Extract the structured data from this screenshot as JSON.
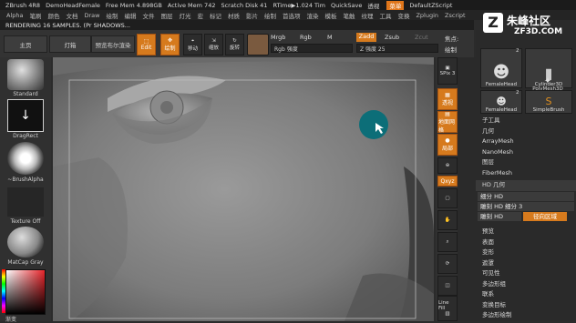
{
  "titlebar": {
    "app": "ZBrush 4R8",
    "doc": "DemoHeadFemale",
    "free_mem": "Free Mem 4.898GB",
    "active_mem": "Active Mem 742",
    "scratch": "Scratch Disk 41",
    "rtime": "RTime▶1.024 Tim",
    "quicksave": "QuickSave",
    "see_through": "透视",
    "menu_btn": "菜单",
    "script": "DefaultZScript"
  },
  "menubar": [
    "Alpha",
    "笔刷",
    "颜色",
    "文档",
    "Draw",
    "绘制",
    "编辑",
    "文件",
    "图层",
    "灯光",
    "宏",
    "标记",
    "材质",
    "影片",
    "绘制",
    "首选项",
    "渲染",
    "模板",
    "笔触",
    "纹理",
    "工具",
    "变换",
    "Zplugin",
    "Zscript"
  ],
  "status": "RENDERING 16 SAMPLES. (Pr  SHADOWS...",
  "shelf": {
    "home": "主页",
    "lightbox": "灯箱",
    "preview": "预览布尔渲染",
    "edit": "Edit",
    "draw": "绘制",
    "move": "移动",
    "scale": "缩放",
    "rotate": "旋转",
    "mrgb": "Mrgb",
    "rgb": "Rgb",
    "m": "M",
    "zadd": "Zadd",
    "zsub": "Zsub",
    "zcut": "Zcut",
    "rgb_intensity": "Rgb 强度",
    "z_intensity": "Z 强度 25",
    "focal": "焦点:",
    "draw_size": "绘制"
  },
  "lefttray": {
    "standard": "Standard",
    "dragrect": "DragRect",
    "brushalpha": "~BrushAlpha",
    "texture": "Texture Off",
    "matcap": "MatCap Gray",
    "gradient": "渐变"
  },
  "righticons": [
    "SPix 3",
    "透视",
    "地面网格",
    "局部",
    "Qxyz",
    "",
    "",
    "",
    "",
    "",
    "",
    "Line Fill"
  ],
  "rightpanel": {
    "logo": "朱峰社区",
    "logo_sub": "ZF3D.COM",
    "thumbs": [
      {
        "label": "FemaleHead",
        "count": "2"
      },
      {
        "label": "Cylinder3D",
        "count": ""
      },
      {
        "label": "PolyMesh3D",
        "count": ""
      },
      {
        "label": "FemaleHead",
        "count": "2"
      },
      {
        "label": "SimpleBrush",
        "count": ""
      }
    ],
    "items1": [
      "子工具",
      "几何",
      "ArrayMesh",
      "NanoMesh",
      "图层",
      "FiberMesh"
    ],
    "hd_header": "HD 几何",
    "hd_rows": [
      "细分 HD",
      "雕刻 HD 细分 3"
    ],
    "hd_tool": "雕刻 HD",
    "hd_region": "径向区域",
    "items2": [
      "预览",
      "表面",
      "变形",
      "遮罩",
      "可见性",
      "多边形组",
      "联系",
      "变换目标",
      "多边形绘制"
    ]
  }
}
